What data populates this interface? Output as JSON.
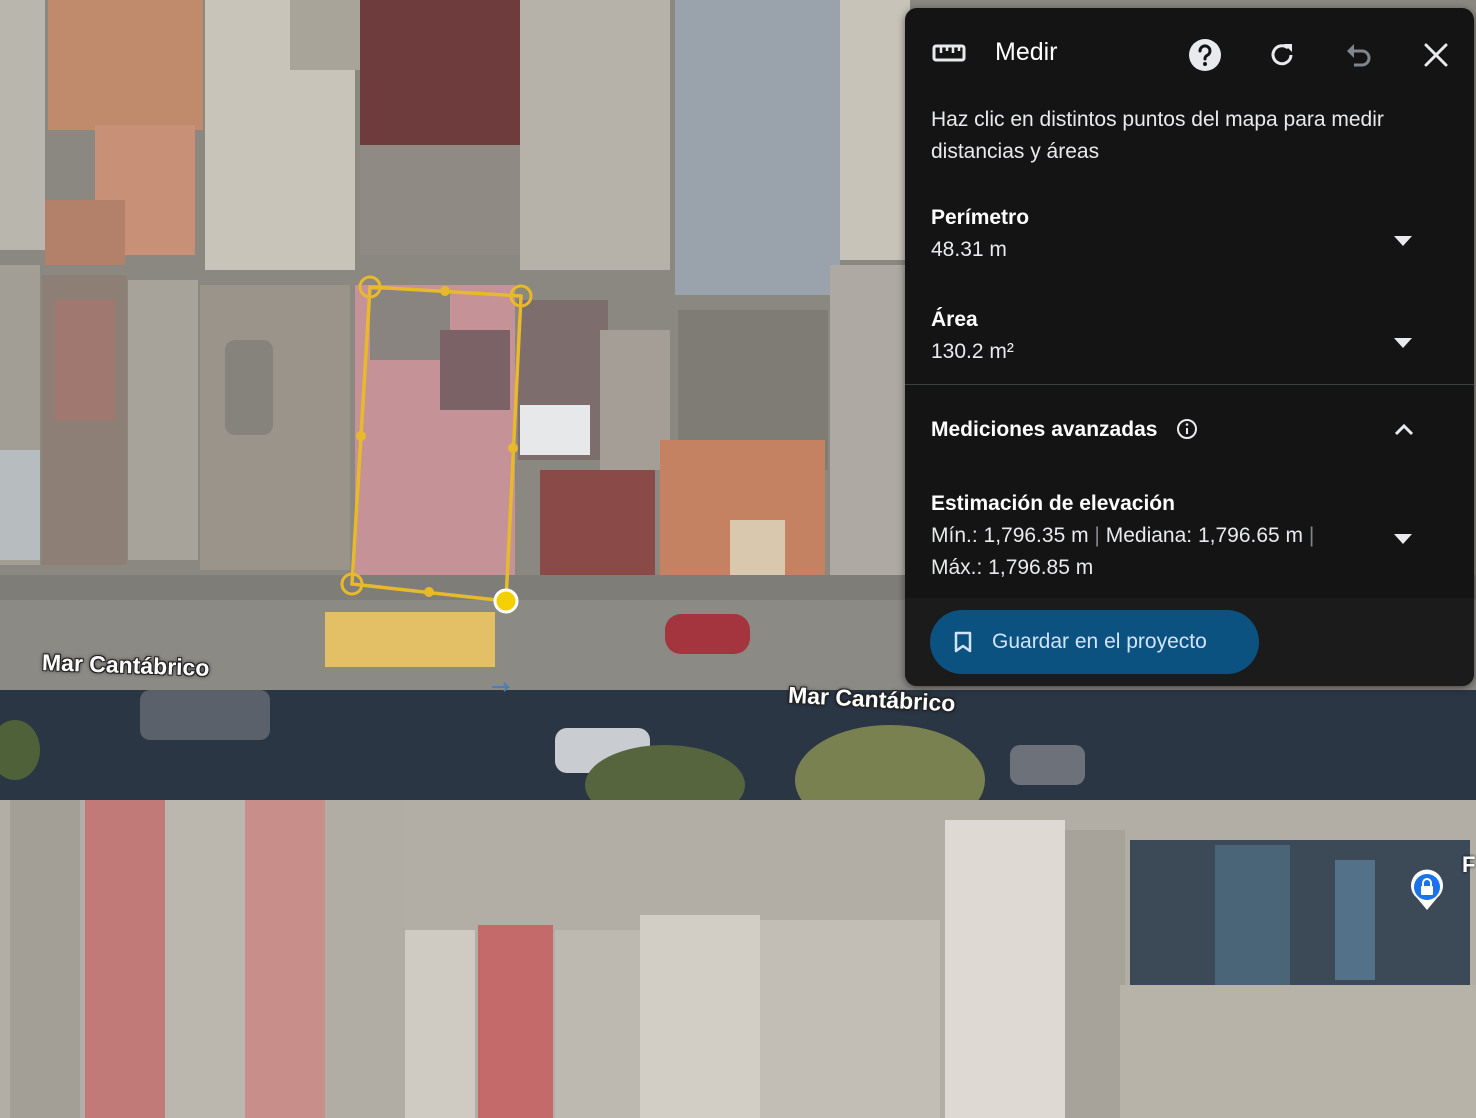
{
  "map": {
    "street_labels": [
      "Mar Cantábrico",
      "Mar Cantábrico"
    ],
    "edge_label": "F",
    "measure_polygon_color": "#e8b92a",
    "place_pin_color": "#1a73e8"
  },
  "panel": {
    "title": "Medir",
    "icons": {
      "tool": "ruler-icon",
      "help": "help-icon",
      "refresh": "refresh-icon",
      "undo": "undo-icon",
      "close": "close-icon"
    },
    "instructions": "Haz clic en distintos puntos del mapa para medir distancias y áreas",
    "perimeter": {
      "label": "Perímetro",
      "value": "48.31 m"
    },
    "area": {
      "label": "Área",
      "value": "130.2 m²"
    },
    "advanced": {
      "label": "Mediciones avanzadas",
      "expanded": true,
      "elevation": {
        "label": "Estimación de elevación",
        "min": "Mín.: 1,796.35 m",
        "median": "Mediana: 1,796.65 m",
        "max": "Máx.: 1,796.85 m"
      }
    },
    "save_button": "Guardar en el proyecto",
    "colors": {
      "panel_bg": "#141414",
      "button_bg": "#0b5281",
      "button_text": "#d2e3fc"
    }
  }
}
